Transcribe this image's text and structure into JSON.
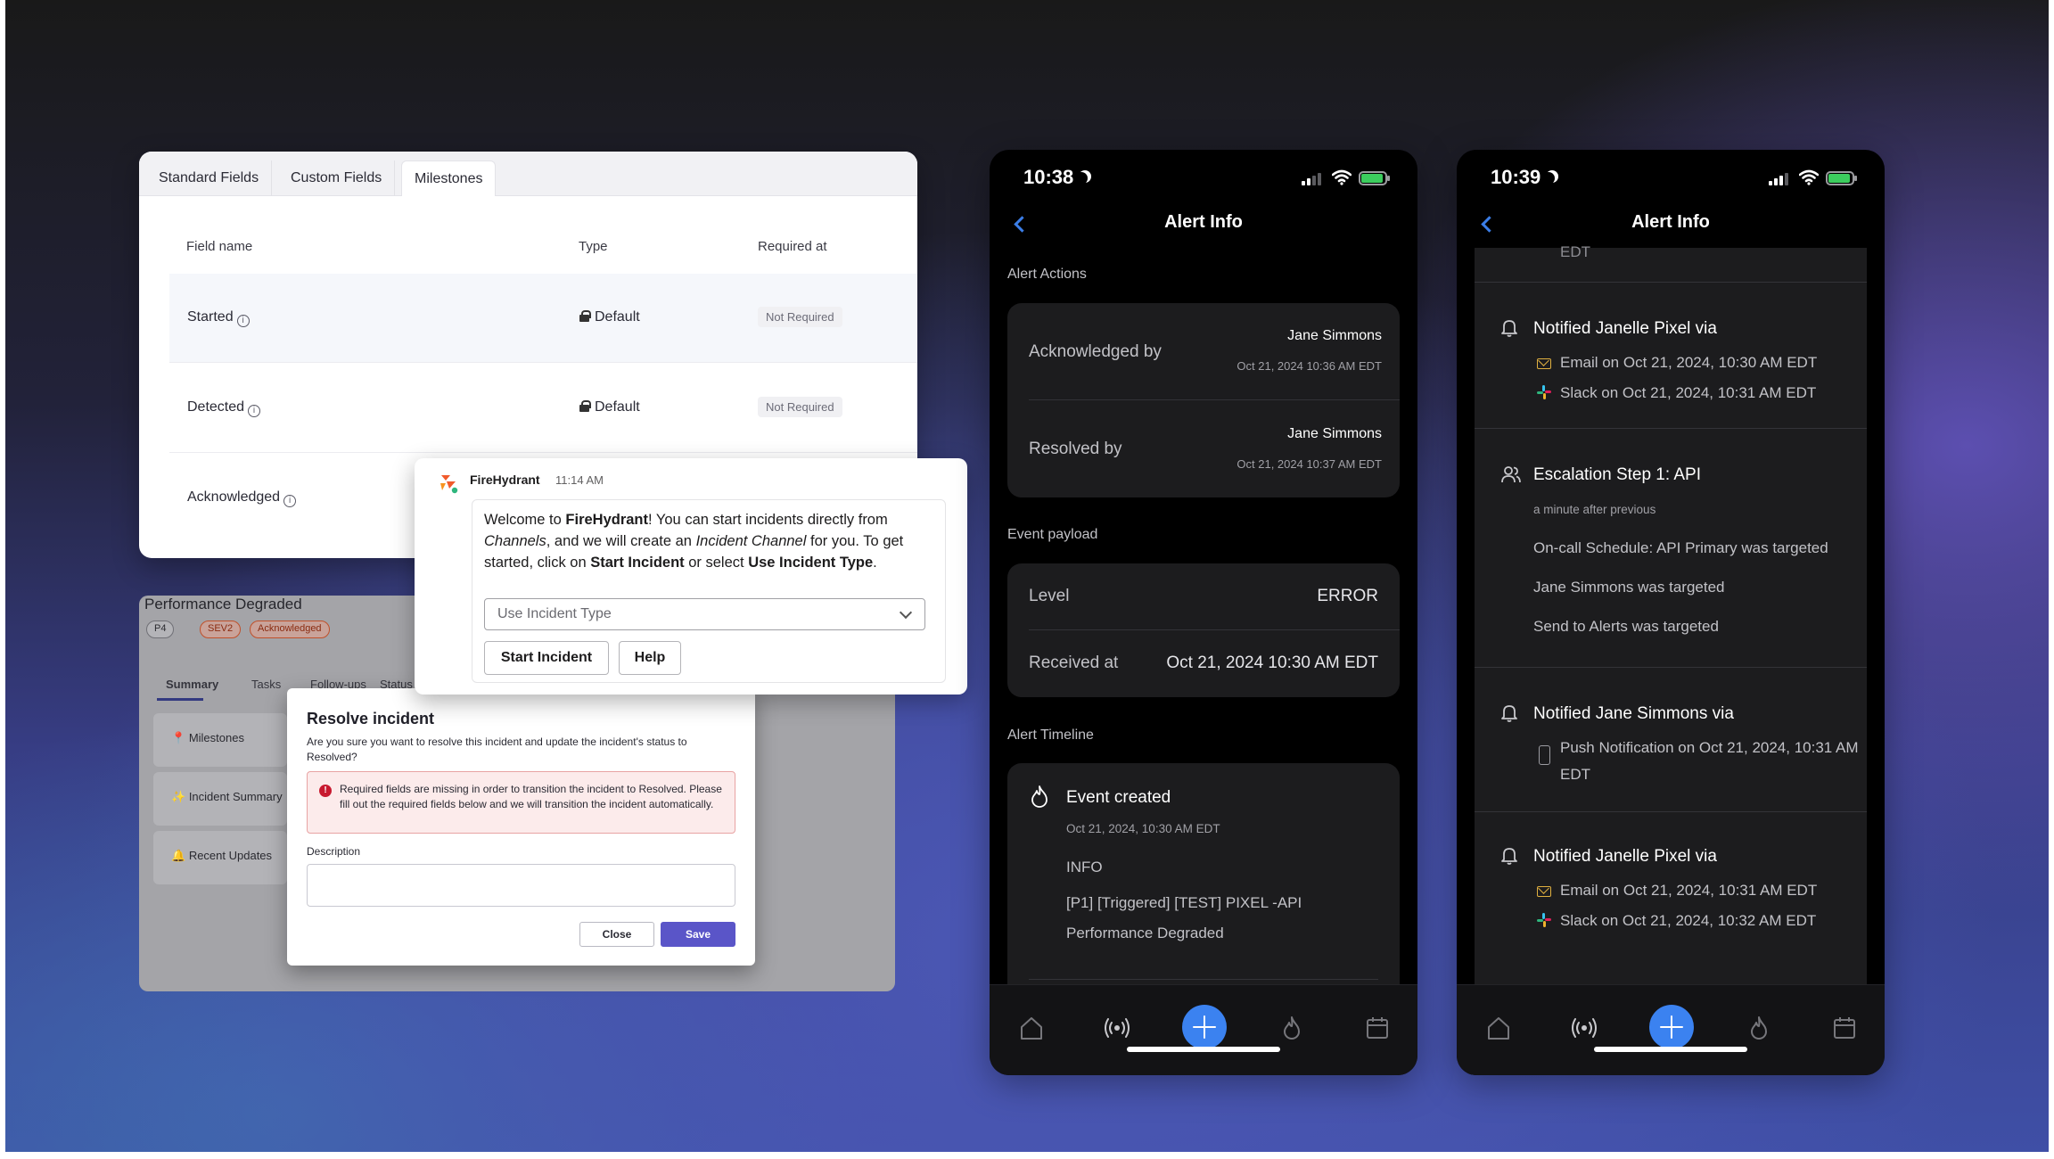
{
  "fields_panel": {
    "tabs": [
      "Standard Fields",
      "Custom Fields",
      "Milestones"
    ],
    "active_tab": "Milestones",
    "columns": [
      "Field name",
      "Type",
      "Required at"
    ],
    "rows": [
      {
        "name": "Started",
        "type": "Default",
        "required": "Not Required"
      },
      {
        "name": "Detected",
        "type": "Default",
        "required": "Not Required"
      },
      {
        "name": "Acknowledged"
      }
    ]
  },
  "incident": {
    "title": "Performance Degraded",
    "pills": [
      "P4",
      "SEV2",
      "Acknowledged"
    ],
    "tabs": [
      "Summary",
      "Tasks",
      "Follow-ups",
      "Status"
    ],
    "side_items": [
      "Milestones",
      "Incident Summary",
      "Recent Updates"
    ]
  },
  "resolve_modal": {
    "title": "Resolve incident",
    "description": "Are you sure you want to resolve this incident and update the incident's status to Resolved?",
    "error": "Required fields are missing in order to transition the incident to Resolved. Please fill out the required fields below and we will transition the incident automatically.",
    "field_label": "Description",
    "close_label": "Close",
    "save_label": "Save"
  },
  "slack": {
    "sender": "FireHydrant",
    "time": "11:14 AM",
    "welcome_pre": "Welcome to ",
    "brand": "FireHydrant",
    "text_1": "! You can start incidents directly from ",
    "channels": "Channels",
    "text_2": ", and we will create an ",
    "incident_channel": "Incident Channel",
    "text_3": " for you. To get started, click on ",
    "start_incident_bold": "Start Incident",
    "text_4": " or select ",
    "use_type_bold": "Use Incident Type",
    "text_5": ".",
    "select_placeholder": "Use Incident Type",
    "start_button": "Start Incident",
    "help_button": "Help"
  },
  "phone1": {
    "time": "10:38",
    "title": "Alert Info",
    "alert_actions_label": "Alert Actions",
    "ack_label": "Acknowledged by",
    "ack_name": "Jane Simmons",
    "ack_time": "Oct 21, 2024 10:36 AM EDT",
    "resolved_label": "Resolved by",
    "resolved_name": "Jane Simmons",
    "resolved_time": "Oct 21, 2024 10:37 AM EDT",
    "payload_label": "Event payload",
    "level_label": "Level",
    "level_value": "ERROR",
    "received_label": "Received at",
    "received_value": "Oct 21, 2024 10:30 AM EDT",
    "timeline_label": "Alert Timeline",
    "event_title": "Event created",
    "event_time": "Oct 21, 2024, 10:30 AM EDT",
    "event_level": "INFO",
    "event_msg_1": "[P1] [Triggered] [TEST] PIXEL -API",
    "event_msg_2": "Performance Degraded"
  },
  "phone2": {
    "time": "10:39",
    "title": "Alert Info",
    "cut_text": "EDT",
    "n1_title": "Notified Janelle Pixel via",
    "n1_email": "Email on Oct 21, 2024, 10:30 AM EDT",
    "n1_slack": "Slack on Oct 21, 2024, 10:31 AM EDT",
    "esc_title": "Escalation Step 1: API",
    "esc_sub": "a minute after previous",
    "esc_1": "On-call Schedule: API Primary was targeted",
    "esc_2": "Jane Simmons was targeted",
    "esc_3": "Send to Alerts was targeted",
    "n2_title": "Notified Jane Simmons via",
    "n2_push_1": "Push Notification on Oct 21, 2024, 10:31 AM",
    "n2_push_2": "EDT",
    "n3_title": "Notified Janelle Pixel via",
    "n3_email": "Email on Oct 21, 2024, 10:31 AM EDT",
    "n3_slack": "Slack on Oct 21, 2024, 10:32 AM EDT"
  },
  "tabbar_icons": [
    "home-icon",
    "broadcast-icon",
    "add-icon",
    "flame-icon",
    "calendar-icon"
  ],
  "colors": {
    "accent": "#3b82f0",
    "save": "#5a55c8",
    "error": "#c8192f"
  }
}
